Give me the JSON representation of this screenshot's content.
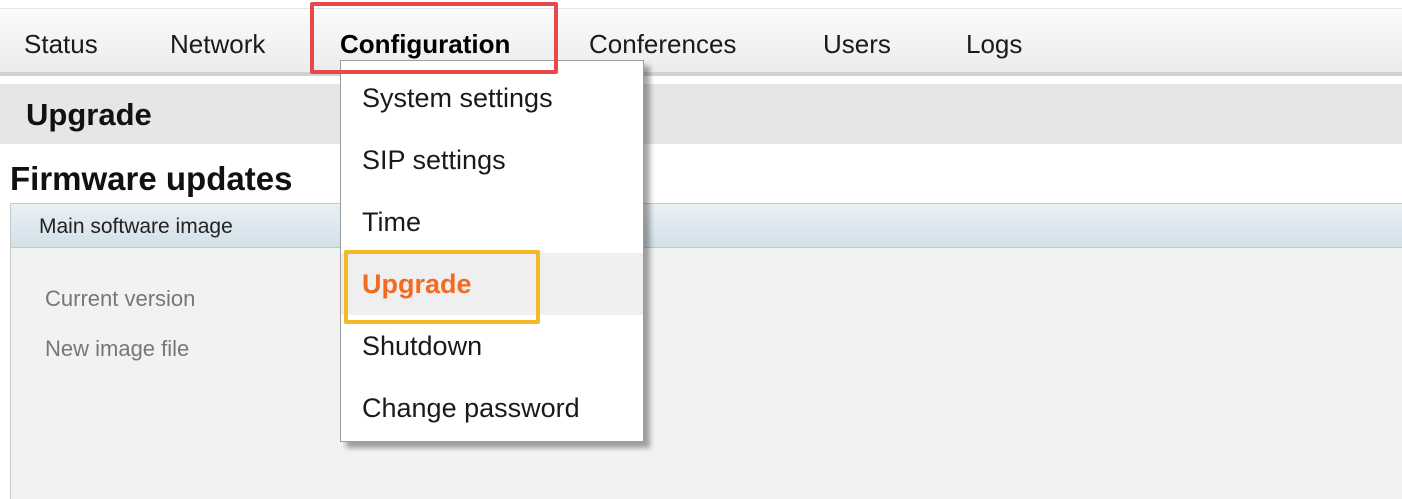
{
  "nav": {
    "items": [
      {
        "label": "Status"
      },
      {
        "label": "Network"
      },
      {
        "label": "Configuration"
      },
      {
        "label": "Conferences"
      },
      {
        "label": "Users"
      },
      {
        "label": "Logs"
      }
    ],
    "active": "Configuration"
  },
  "page": {
    "title": "Upgrade",
    "section_title": "Firmware updates"
  },
  "panel": {
    "header": "Main software image",
    "fields": [
      {
        "label": "Current version"
      },
      {
        "label": "New image file"
      }
    ]
  },
  "dropdown": {
    "items": [
      {
        "label": "System settings"
      },
      {
        "label": "SIP settings"
      },
      {
        "label": "Time"
      },
      {
        "label": "Upgrade"
      },
      {
        "label": "Shutdown"
      },
      {
        "label": "Change password"
      }
    ],
    "selected": "Upgrade"
  },
  "colors": {
    "nav_highlight": "#e8474c",
    "menu_highlight": "#f5b82a",
    "selected_text": "#f36a21"
  }
}
